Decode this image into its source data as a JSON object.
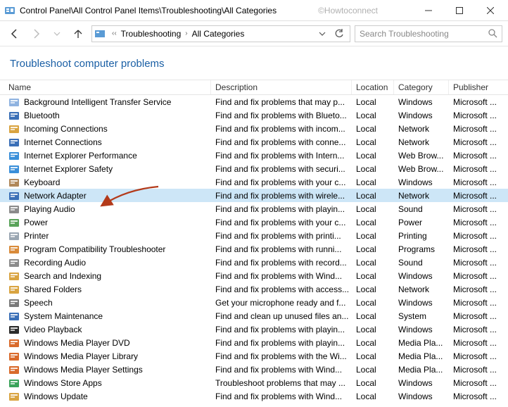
{
  "titlebar": {
    "path": "Control Panel\\All Control Panel Items\\Troubleshooting\\All Categories",
    "watermark": "©Howtoconnect"
  },
  "breadcrumb": {
    "seg1": "Troubleshooting",
    "seg2": "All Categories"
  },
  "search": {
    "placeholder": "Search Troubleshooting"
  },
  "heading": "Troubleshoot computer problems",
  "columns": {
    "name": "Name",
    "description": "Description",
    "location": "Location",
    "category": "Category",
    "publisher": "Publisher"
  },
  "selected_index": 7,
  "items": [
    {
      "name": "Background Intelligent Transfer Service",
      "desc": "Find and fix problems that may p...",
      "loc": "Local",
      "cat": "Windows",
      "pub": "Microsoft ...",
      "color": "#8fb3e0"
    },
    {
      "name": "Bluetooth",
      "desc": "Find and fix problems with Blueto...",
      "loc": "Local",
      "cat": "Windows",
      "pub": "Microsoft ...",
      "color": "#3a6fb7"
    },
    {
      "name": "Incoming Connections",
      "desc": "Find and fix problems with incom...",
      "loc": "Local",
      "cat": "Network",
      "pub": "Microsoft ...",
      "color": "#d9a441"
    },
    {
      "name": "Internet Connections",
      "desc": "Find and fix problems with conne...",
      "loc": "Local",
      "cat": "Network",
      "pub": "Microsoft ...",
      "color": "#3a6fb7"
    },
    {
      "name": "Internet Explorer Performance",
      "desc": "Find and fix problems with Intern...",
      "loc": "Local",
      "cat": "Web Brow...",
      "pub": "Microsoft ...",
      "color": "#3a8fd9"
    },
    {
      "name": "Internet Explorer Safety",
      "desc": "Find and fix problems with securi...",
      "loc": "Local",
      "cat": "Web Brow...",
      "pub": "Microsoft ...",
      "color": "#3a8fd9"
    },
    {
      "name": "Keyboard",
      "desc": "Find and fix problems with your c...",
      "loc": "Local",
      "cat": "Windows",
      "pub": "Microsoft ...",
      "color": "#b0885a"
    },
    {
      "name": "Network Adapter",
      "desc": "Find and fix problems with wirele...",
      "loc": "Local",
      "cat": "Network",
      "pub": "Microsoft ...",
      "color": "#3a6fb7"
    },
    {
      "name": "Playing Audio",
      "desc": "Find and fix problems with playin...",
      "loc": "Local",
      "cat": "Sound",
      "pub": "Microsoft ...",
      "color": "#8b8b8b"
    },
    {
      "name": "Power",
      "desc": "Find and fix problems with your c...",
      "loc": "Local",
      "cat": "Power",
      "pub": "Microsoft ...",
      "color": "#5aa35a"
    },
    {
      "name": "Printer",
      "desc": "Find and fix problems with printi...",
      "loc": "Local",
      "cat": "Printing",
      "pub": "Microsoft ...",
      "color": "#9aa6b2"
    },
    {
      "name": "Program Compatibility Troubleshooter",
      "desc": "Find and fix problems with runni...",
      "loc": "Local",
      "cat": "Programs",
      "pub": "Microsoft ...",
      "color": "#d98b3a"
    },
    {
      "name": "Recording Audio",
      "desc": "Find and fix problems with record...",
      "loc": "Local",
      "cat": "Sound",
      "pub": "Microsoft ...",
      "color": "#8b8b8b"
    },
    {
      "name": "Search and Indexing",
      "desc": "Find and fix problems with Wind...",
      "loc": "Local",
      "cat": "Windows",
      "pub": "Microsoft ...",
      "color": "#d9a441"
    },
    {
      "name": "Shared Folders",
      "desc": "Find and fix problems with access...",
      "loc": "Local",
      "cat": "Network",
      "pub": "Microsoft ...",
      "color": "#d9a441"
    },
    {
      "name": "Speech",
      "desc": "Get your microphone ready and f...",
      "loc": "Local",
      "cat": "Windows",
      "pub": "Microsoft ...",
      "color": "#7a7a7a"
    },
    {
      "name": "System Maintenance",
      "desc": "Find and clean up unused files an...",
      "loc": "Local",
      "cat": "System",
      "pub": "Microsoft ...",
      "color": "#3a6fb7"
    },
    {
      "name": "Video Playback",
      "desc": "Find and fix problems with playin...",
      "loc": "Local",
      "cat": "Windows",
      "pub": "Microsoft ...",
      "color": "#2b2b2b"
    },
    {
      "name": "Windows Media Player DVD",
      "desc": "Find and fix problems with playin...",
      "loc": "Local",
      "cat": "Media Pla...",
      "pub": "Microsoft ...",
      "color": "#d96a2b"
    },
    {
      "name": "Windows Media Player Library",
      "desc": "Find and fix problems with the Wi...",
      "loc": "Local",
      "cat": "Media Pla...",
      "pub": "Microsoft ...",
      "color": "#d96a2b"
    },
    {
      "name": "Windows Media Player Settings",
      "desc": "Find and fix problems with Wind...",
      "loc": "Local",
      "cat": "Media Pla...",
      "pub": "Microsoft ...",
      "color": "#d96a2b"
    },
    {
      "name": "Windows Store Apps",
      "desc": "Troubleshoot problems that may ...",
      "loc": "Local",
      "cat": "Windows",
      "pub": "Microsoft ...",
      "color": "#3aa35a"
    },
    {
      "name": "Windows Update",
      "desc": "Find and fix problems with Wind...",
      "loc": "Local",
      "cat": "Windows",
      "pub": "Microsoft ...",
      "color": "#d9a441"
    }
  ]
}
